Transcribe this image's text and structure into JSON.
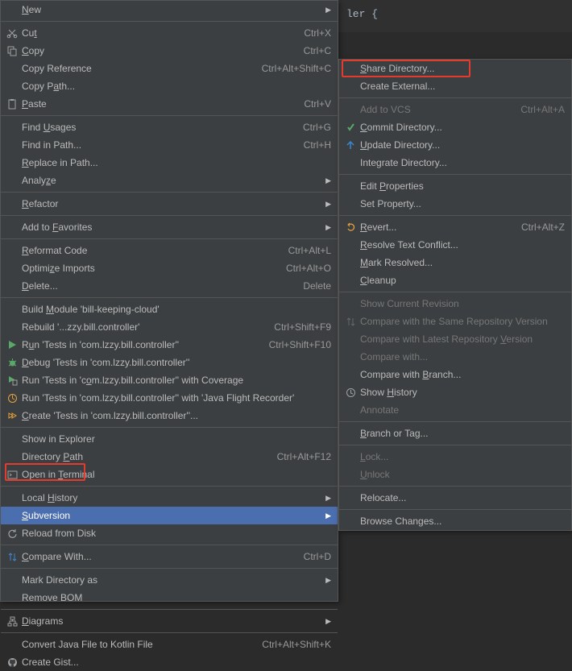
{
  "editor_snippet": "ler {",
  "main_menu": {
    "new": {
      "label": "New",
      "mn": "N",
      "shortcut": "",
      "arrow": true
    },
    "cut": {
      "label": "Cut",
      "mn": "t",
      "shortcut": "Ctrl+X"
    },
    "copy": {
      "label": "Copy",
      "mn": "C",
      "shortcut": "Ctrl+C"
    },
    "copy_reference": {
      "label": "Copy Reference",
      "shortcut": "Ctrl+Alt+Shift+C"
    },
    "copy_path": {
      "label": "Copy Path...",
      "mn": "a"
    },
    "paste": {
      "label": "Paste",
      "mn": "P",
      "shortcut": "Ctrl+V"
    },
    "find_usages": {
      "label": "Find Usages",
      "mn": "U",
      "shortcut": "Ctrl+G"
    },
    "find_in_path": {
      "label": "Find in Path...",
      "shortcut": "Ctrl+H"
    },
    "replace_in_path": {
      "label": "Replace in Path...",
      "mn": "R"
    },
    "analyze": {
      "label": "Analyze",
      "mn": "z",
      "arrow": true
    },
    "refactor": {
      "label": "Refactor",
      "mn": "R",
      "arrow": true
    },
    "add_to_favorites": {
      "label": "Add to Favorites",
      "mn": "F",
      "arrow": true
    },
    "reformat_code": {
      "label": "Reformat Code",
      "mn": "R",
      "shortcut": "Ctrl+Alt+L"
    },
    "optimize_imports": {
      "label": "Optimize Imports",
      "mn": "z",
      "shortcut": "Ctrl+Alt+O"
    },
    "delete": {
      "label": "Delete...",
      "mn": "D",
      "shortcut": "Delete"
    },
    "build_module": {
      "label": "Build Module 'bill-keeping-cloud'",
      "mn": "M"
    },
    "rebuild": {
      "label": "Rebuild '...zzy.bill.controller'",
      "shortcut": "Ctrl+Shift+F9"
    },
    "run_tests": {
      "label": "Run 'Tests in 'com.lzzy.bill.controller''",
      "mn": "u",
      "shortcut": "Ctrl+Shift+F10"
    },
    "debug_tests": {
      "label": "Debug 'Tests in 'com.lzzy.bill.controller''",
      "mn": "D"
    },
    "run_coverage": {
      "label": "Run 'Tests in 'com.lzzy.bill.controller'' with Coverage",
      "mn": "o"
    },
    "run_jfr": {
      "label": "Run 'Tests in 'com.lzzy.bill.controller'' with 'Java Flight Recorder'"
    },
    "create_tests": {
      "label": "Create 'Tests in 'com.lzzy.bill.controller''...",
      "mn": "C"
    },
    "show_in_explorer": {
      "label": "Show in Explorer"
    },
    "directory_path": {
      "label": "Directory Path",
      "mn": "P",
      "shortcut": "Ctrl+Alt+F12"
    },
    "open_in_terminal": {
      "label": "Open in Terminal",
      "mn": "T"
    },
    "local_history": {
      "label": "Local History",
      "mn": "H",
      "arrow": true
    },
    "subversion": {
      "label": "Subversion",
      "mn": "S",
      "arrow": true,
      "selected": true
    },
    "reload_from_disk": {
      "label": "Reload from Disk"
    },
    "compare_with": {
      "label": "Compare With...",
      "mn": "C",
      "shortcut": "Ctrl+D"
    },
    "mark_directory_as": {
      "label": "Mark Directory as",
      "arrow": true
    },
    "remove_bom": {
      "label": "Remove BOM"
    },
    "diagrams": {
      "label": "Diagrams",
      "mn": "D",
      "arrow": true
    },
    "convert_kotlin": {
      "label": "Convert Java File to Kotlin File",
      "shortcut": "Ctrl+Alt+Shift+K"
    },
    "create_gist": {
      "label": "Create Gist..."
    }
  },
  "sub_menu": {
    "share_directory": {
      "label": "Share Directory...",
      "mn": "S"
    },
    "create_external": {
      "label": "Create External..."
    },
    "add_to_vcs": {
      "label": "Add to VCS",
      "shortcut": "Ctrl+Alt+A",
      "disabled": true
    },
    "commit_directory": {
      "label": "Commit Directory...",
      "mn": "C"
    },
    "update_directory": {
      "label": "Update Directory...",
      "mn": "U"
    },
    "integrate_directory": {
      "label": "Integrate Directory..."
    },
    "edit_properties": {
      "label": "Edit Properties",
      "mn": "P"
    },
    "set_property": {
      "label": "Set Property..."
    },
    "revert": {
      "label": "Revert...",
      "mn": "R",
      "shortcut": "Ctrl+Alt+Z"
    },
    "resolve_conflict": {
      "label": "Resolve Text Conflict...",
      "mn": "R"
    },
    "mark_resolved": {
      "label": "Mark Resolved...",
      "mn": "M"
    },
    "cleanup": {
      "label": "Cleanup",
      "mn": "C"
    },
    "show_current_rev": {
      "label": "Show Current Revision",
      "disabled": true
    },
    "compare_same_repo": {
      "label": "Compare with the Same Repository Version",
      "disabled": true
    },
    "compare_latest_repo": {
      "label": "Compare with Latest Repository Version",
      "mn": "V",
      "disabled": true
    },
    "compare_with": {
      "label": "Compare with...",
      "disabled": true
    },
    "compare_branch": {
      "label": "Compare with Branch...",
      "mn": "B"
    },
    "show_history": {
      "label": "Show History",
      "mn": "H"
    },
    "annotate": {
      "label": "Annotate",
      "disabled": true
    },
    "branch_or_tag": {
      "label": "Branch or Tag...",
      "mn": "B"
    },
    "lock": {
      "label": "Lock...",
      "mn": "L",
      "disabled": true
    },
    "unlock": {
      "label": "Unlock",
      "mn": "U",
      "disabled": true
    },
    "relocate": {
      "label": "Relocate..."
    },
    "browse_changes": {
      "label": "Browse Changes..."
    }
  }
}
